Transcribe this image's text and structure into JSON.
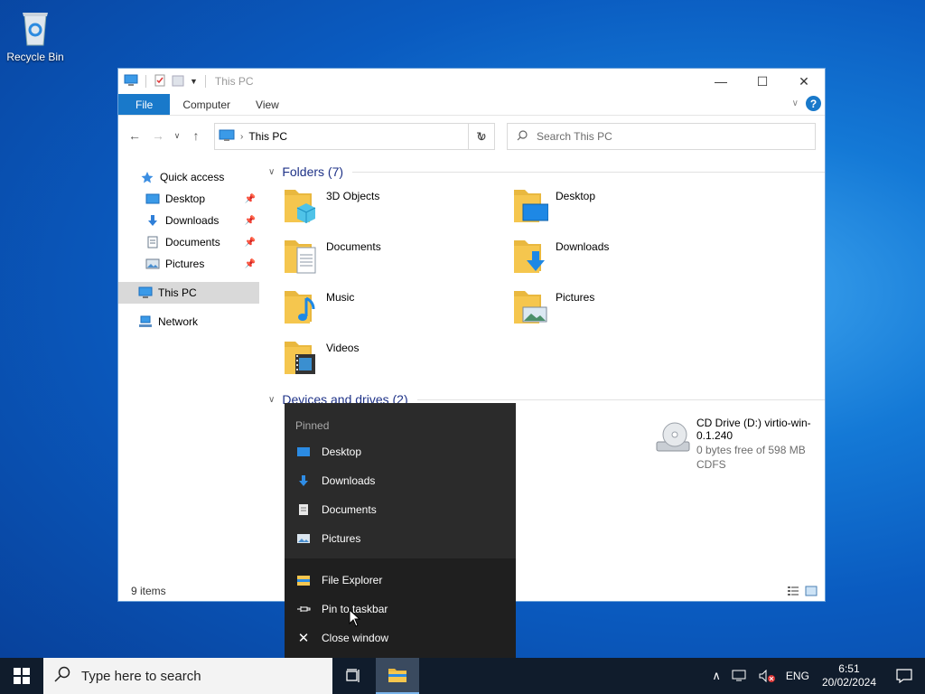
{
  "desktop": {
    "recycle_bin": "Recycle Bin"
  },
  "window": {
    "title": "This PC",
    "ribbon_tabs": [
      "File",
      "Computer",
      "View"
    ],
    "address": "This PC",
    "search_placeholder": "Search This PC",
    "sidebar": [
      {
        "label": "Quick access",
        "icon": "star-icon",
        "pinned": false
      },
      {
        "label": "Desktop",
        "icon": "desktop-folder-icon",
        "pinned": true
      },
      {
        "label": "Downloads",
        "icon": "download-arrow-icon",
        "pinned": true
      },
      {
        "label": "Documents",
        "icon": "document-icon",
        "pinned": true
      },
      {
        "label": "Pictures",
        "icon": "pictures-icon",
        "pinned": true
      },
      {
        "label": "This PC",
        "icon": "computer-icon",
        "selected": true
      },
      {
        "label": "Network",
        "icon": "network-icon"
      }
    ],
    "folders_header": "Folders (7)",
    "folders": [
      "3D Objects",
      "Desktop",
      "Documents",
      "Downloads",
      "Music",
      "Pictures",
      "Videos"
    ],
    "devices_header": "Devices and drives (2)",
    "drive": {
      "name": "CD Drive (D:) virtio-win-0.1.240",
      "free": "0 bytes free of 598 MB",
      "fs": "CDFS"
    },
    "status": "9 items"
  },
  "jumplist": {
    "header": "Pinned",
    "pinned": [
      "Desktop",
      "Downloads",
      "Documents",
      "Pictures"
    ],
    "actions": [
      "File Explorer",
      "Pin to taskbar",
      "Close window"
    ]
  },
  "taskbar": {
    "search_placeholder": "Type here to search",
    "lang": "ENG",
    "time": "6:51",
    "date": "20/02/2024"
  },
  "colors": {
    "accent": "#1979ca",
    "folder": "#f5c64e"
  }
}
